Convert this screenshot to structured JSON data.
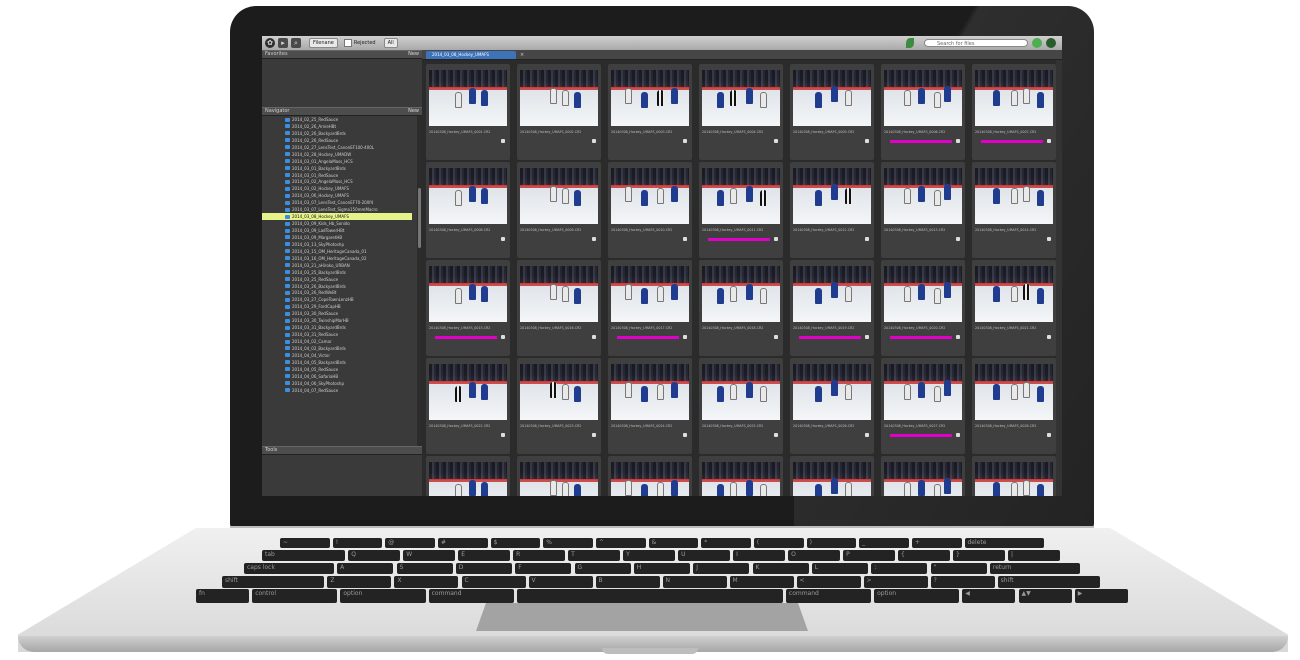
{
  "toolbar": {
    "filter_select": "Filenane",
    "checkbox_label": "Rejected",
    "all_select": "All",
    "search_placeholder": "Search for files"
  },
  "panels": {
    "favorites_title": "Favorites",
    "favorites_new": "New",
    "navigator_title": "Navigator",
    "navigator_new": "New",
    "tools_title": "Tools"
  },
  "content_tab": "2014_03_08_Hockey_UMAFS",
  "folders": [
    "2014_02_25_RedSauce",
    "2014_02_26_ArnieHBt",
    "2014_02_26_BackyardBrds",
    "2014_02_26_RedSauce",
    "2014_02_27_LensTest_CanonEF100-400L",
    "2014_02_28_Hockey_UMADW",
    "2014_03_01_AngelaMass_HCS",
    "2014_03_01_BackyardBrds",
    "2014_03_01_RedSauce",
    "2014_03_02_AngelaMass_HCS",
    "2014_03_02_Hockey_UMAFS",
    "2014_03_06_Hockey_UMAFS",
    "2014_03_07_LensTest_CanonEF70-200f4",
    "2014_03_07_LensTest_Sigma150mmMacro",
    "2014_03_08_Hockey_UMAFS",
    "2014_03_09_Kids_Hb_Sonido",
    "2014_03_09_LadTowerHBt",
    "2014_03_09_MargaretHB",
    "2014_03_13_SkyPhotoshp",
    "2014_03_15_OM_HeritageCanada_01",
    "2014_03_16_OM_HeritageCanada_02",
    "2014_03_21_aHiroko_URBAN",
    "2014_03_25_BackyardBrds",
    "2014_03_25_RedSauce",
    "2014_03_26_BackyardBrds",
    "2014_03_26_RedWeBt",
    "2014_03_27_CopeTownLenzHB",
    "2014_03_29_FordCapHB",
    "2014_03_30_RedSauce",
    "2014_03_30_TwinshipMarHB",
    "2014_03_31_BackyardBrds",
    "2014_03_31_RedSauce",
    "2014_04_02_Camar",
    "2014_04_02_BackyardBrds",
    "2014_04_04_Victor",
    "2014_04_05_BackyardBrds",
    "2014_04_05_RedSauce",
    "2014_04_06_SafariaHB",
    "2014_04_06_SkyPhotoshp",
    "2014_04_07_RedSauce"
  ],
  "selected_folder": "2014_03_08_Hockey_UMAFS",
  "photo_prefix": "20140308_Hockey_UMAFS_",
  "photos": [
    {
      "file": "20140308_Hockey_UMAFS_0001.CR2",
      "label": false
    },
    {
      "file": "20140308_Hockey_UMAFS_0002.CR2",
      "label": false
    },
    {
      "file": "20140308_Hockey_UMAFS_0003.CR2",
      "label": false
    },
    {
      "file": "20140308_Hockey_UMAFS_0004.CR2",
      "label": false
    },
    {
      "file": "20140308_Hockey_UMAFS_0005.CR2",
      "label": false
    },
    {
      "file": "20140308_Hockey_UMAFS_0006.CR2",
      "label": true
    },
    {
      "file": "20140308_Hockey_UMAFS_0007.CR2",
      "label": true
    },
    {
      "file": "20140308_Hockey_UMAFS_0008.CR2",
      "label": false
    },
    {
      "file": "20140308_Hockey_UMAFS_0009.CR2",
      "label": false
    },
    {
      "file": "20140308_Hockey_UMAFS_0010.CR2",
      "label": false
    },
    {
      "file": "20140308_Hockey_UMAFS_0011.CR2",
      "label": true
    },
    {
      "file": "20140308_Hockey_UMAFS_0012.CR2",
      "label": false
    },
    {
      "file": "20140308_Hockey_UMAFS_0013.CR2",
      "label": false
    },
    {
      "file": "20140308_Hockey_UMAFS_0014.CR2",
      "label": false
    },
    {
      "file": "20140308_Hockey_UMAFS_0015.CR2",
      "label": true
    },
    {
      "file": "20140308_Hockey_UMAFS_0016.CR2",
      "label": false
    },
    {
      "file": "20140308_Hockey_UMAFS_0017.CR2",
      "label": true
    },
    {
      "file": "20140308_Hockey_UMAFS_0018.CR2",
      "label": false
    },
    {
      "file": "20140308_Hockey_UMAFS_0019.CR2",
      "label": true
    },
    {
      "file": "20140308_Hockey_UMAFS_0020.CR2",
      "label": true
    },
    {
      "file": "20140308_Hockey_UMAFS_0021.CR2",
      "label": false
    },
    {
      "file": "20140308_Hockey_UMAFS_0022.CR2",
      "label": false
    },
    {
      "file": "20140308_Hockey_UMAFS_0023.CR2",
      "label": false
    },
    {
      "file": "20140308_Hockey_UMAFS_0024.CR2",
      "label": false
    },
    {
      "file": "20140308_Hockey_UMAFS_0025.CR2",
      "label": false
    },
    {
      "file": "20140308_Hockey_UMAFS_0026.CR2",
      "label": false
    },
    {
      "file": "20140308_Hockey_UMAFS_0027.CR2",
      "label": true
    },
    {
      "file": "20140308_Hockey_UMAFS_0028.CR2",
      "label": false
    },
    {
      "file": "",
      "label": false
    },
    {
      "file": "",
      "label": false
    },
    {
      "file": "",
      "label": false
    },
    {
      "file": "",
      "label": false
    },
    {
      "file": "",
      "label": false
    },
    {
      "file": "",
      "label": false
    },
    {
      "file": "",
      "label": false
    }
  ],
  "keyboard": {
    "row1": [
      "~",
      "!",
      "@",
      "#",
      "$",
      "%",
      "^",
      "&",
      "*",
      "(",
      ")",
      "_",
      "+",
      "delete"
    ],
    "row2": [
      "tab",
      "Q",
      "W",
      "E",
      "R",
      "T",
      "Y",
      "U",
      "I",
      "O",
      "P",
      "{",
      "}",
      "|"
    ],
    "row3": [
      "caps lock",
      "A",
      "S",
      "D",
      "F",
      "G",
      "H",
      "J",
      "K",
      "L",
      ":",
      "\"",
      "return"
    ],
    "row4": [
      "shift",
      "Z",
      "X",
      "C",
      "V",
      "B",
      "N",
      "M",
      "<",
      ">",
      "?",
      "shift"
    ],
    "row5": [
      "fn",
      "control",
      "option",
      "command",
      "",
      "command",
      "option",
      "◀",
      "▲▼",
      "▶"
    ]
  },
  "colors": {
    "label_magenta": "#e000c8",
    "selected_folder_bg": "#e6f28a",
    "tab_blue": "#3d73b8"
  }
}
